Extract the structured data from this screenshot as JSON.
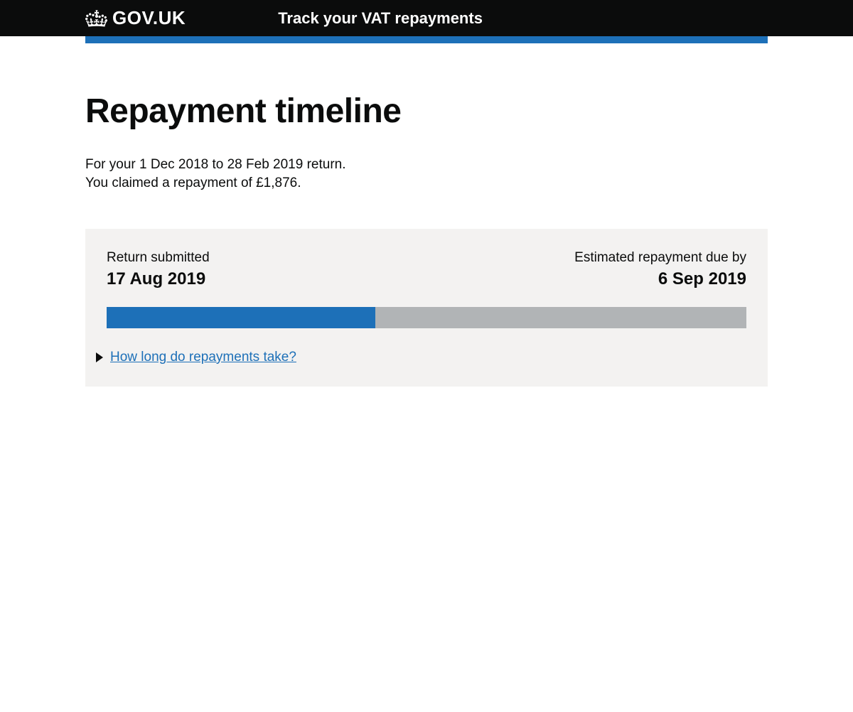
{
  "header": {
    "logo_text": "GOV.UK",
    "service_name": "Track your VAT repayments"
  },
  "page": {
    "title": "Repayment timeline",
    "intro_line1": "For your 1 Dec 2018 to 28 Feb 2019 return.",
    "intro_line2": "You claimed a repayment of £1,876."
  },
  "timeline": {
    "submitted_label": "Return submitted",
    "submitted_date": "17 Aug 2019",
    "due_label": "Estimated repayment due by",
    "due_date": "6 Sep 2019",
    "progress_percent": 42
  },
  "details": {
    "summary": "How long do repayments take?"
  }
}
